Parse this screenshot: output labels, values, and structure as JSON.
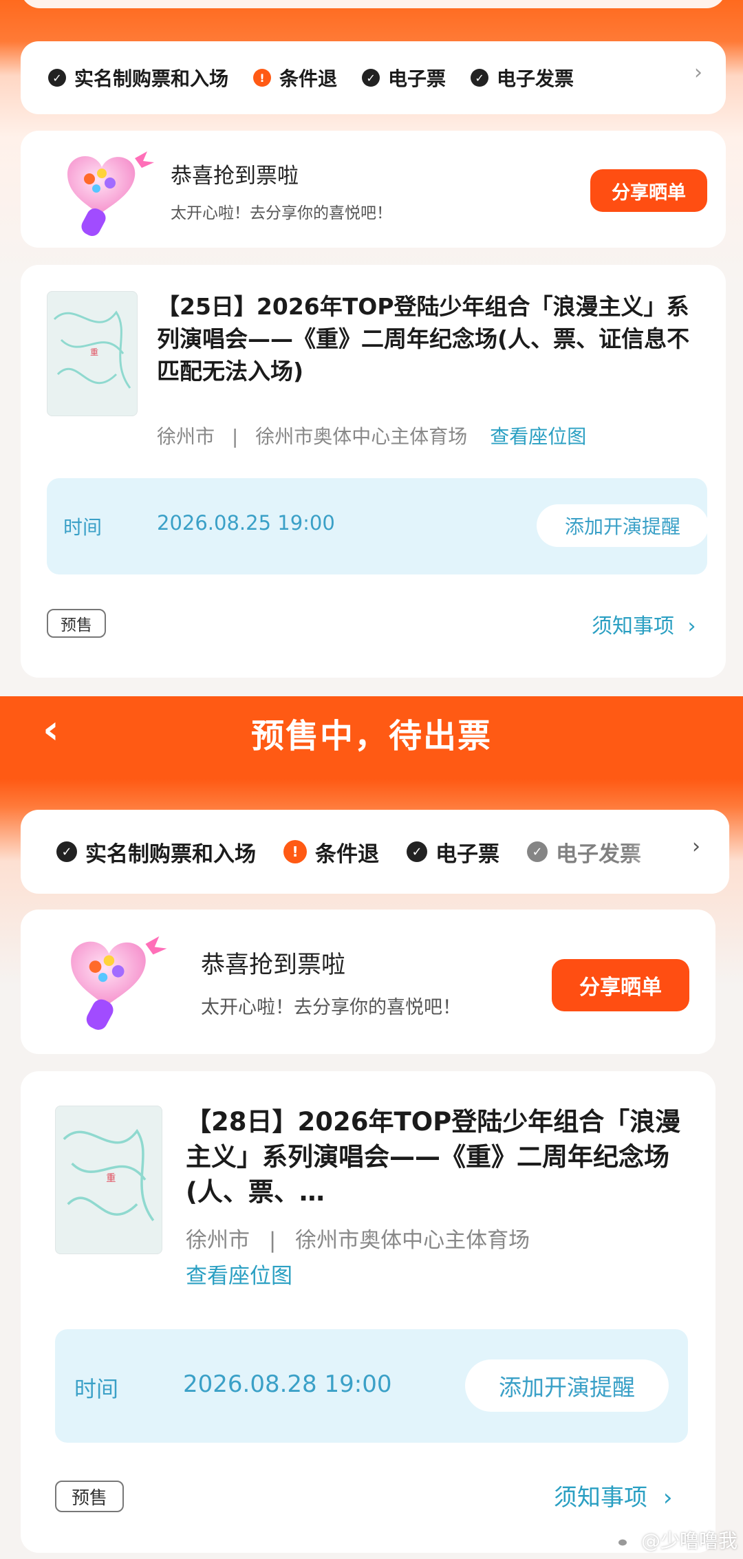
{
  "header": {
    "back_icon": "chevron-left-icon",
    "title": "预售中，待出票"
  },
  "features": [
    {
      "icon": "check-circle-icon",
      "label": "实名制购票和入场"
    },
    {
      "icon": "exclamation-circle-icon",
      "label": "条件退"
    },
    {
      "icon": "check-circle-icon",
      "label": "电子票"
    },
    {
      "icon": "check-circle-icon",
      "label": "电子发票"
    }
  ],
  "congrats": {
    "title": "恭喜抢到票啦",
    "subtitle": "太开心啦！去分享你的喜悦吧！",
    "share_label": "分享晒单"
  },
  "order1": {
    "title": "【25日】2026年TOP登陆少年组合「浪漫主义」系列演唱会——《重》二周年纪念场(人、票、证信息不匹配无法入场)",
    "city": "徐州市",
    "separator": "|",
    "venue": "徐州市奥体中心主体育场",
    "seat_map": "查看座位图",
    "time_label": "时间",
    "time_value": "2026.08.25 19:00",
    "remind_label": "添加开演提醒",
    "badge": "预售",
    "notice": "须知事项",
    "notice_icon": "chevron-right-icon"
  },
  "order2": {
    "title": "【28日】2026年TOP登陆少年组合「浪漫主义」系列演唱会——《重》二周年纪念场(人、票、…",
    "city": "徐州市",
    "separator": "|",
    "venue": "徐州市奥体中心主体育场",
    "seat_map": "查看座位图",
    "time_label": "时间",
    "time_value": "2026.08.28 19:00",
    "remind_label": "添加开演提醒",
    "badge": "预售",
    "notice": "须知事项",
    "notice_icon": "chevron-right-icon"
  },
  "watermark": {
    "icon": "weibo-icon",
    "text": "@少噜噜我"
  },
  "colors": {
    "accent": "#ff5a14",
    "link": "#2a9fc2",
    "time_bg": "#e2f4fb"
  }
}
